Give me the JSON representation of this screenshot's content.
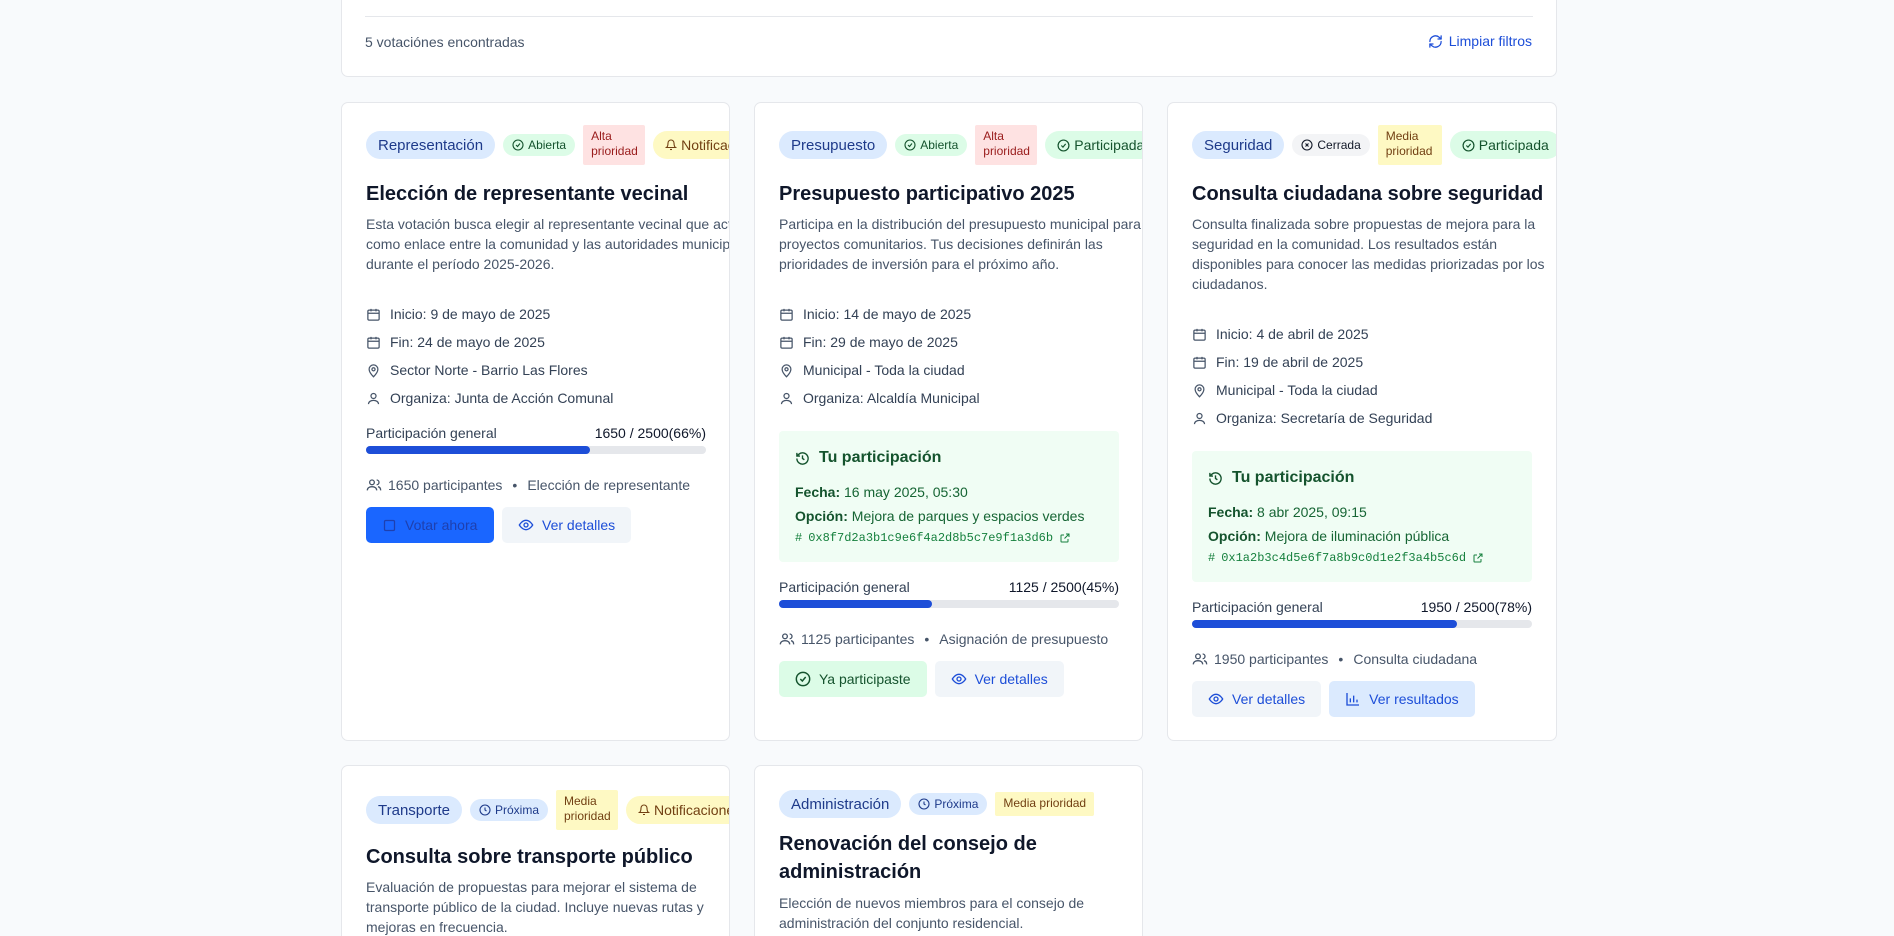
{
  "results": {
    "count_text": "5 votaciónes encontradas",
    "clear_label": "Limpiar filtros"
  },
  "cards": [
    {
      "category": "Representación",
      "status": "Abierta",
      "priority": "Alta prioridad",
      "extra_badge": "Notificaciones",
      "title": "Elección de representante vecinal",
      "description": "Esta votación busca elegir al representante vecinal que actuará como enlace entre la comunidad y las autoridades municipales durante el período 2025-2026.",
      "start": "Inicio: 9 de mayo de 2025",
      "end": "Fin: 24 de mayo de 2025",
      "location": "Sector Norte - Barrio Las Flores",
      "organizer": "Organiza: Junta de Acción Comunal",
      "progress_label": "Participación general",
      "progress_value": "1650 / 2500(66%)",
      "progress_fraction": 0.66,
      "participants": "1650 participantes",
      "vote_type": "Elección de representante",
      "primary_action": "Votar ahora",
      "details_action": "Ver detalles"
    },
    {
      "category": "Presupuesto",
      "status": "Abierta",
      "priority": "Alta prioridad",
      "extra_badge": "Participada",
      "title": "Presupuesto participativo 2025",
      "description": "Participa en la distribución del presupuesto municipal para proyectos comunitarios. Tus decisiones definirán las prioridades de inversión para el próximo año.",
      "start": "Inicio: 14 de mayo de 2025",
      "end": "Fin: 29 de mayo de 2025",
      "location": "Municipal - Toda la ciudad",
      "organizer": "Organiza: Alcaldía Municipal",
      "my_participation": {
        "title": "Tu participación",
        "date_label": "Fecha:",
        "date": "16 may 2025, 05:30",
        "option_label": "Opción:",
        "option": "Mejora de parques y espacios verdes",
        "hash": "0x8f7d2a3b1c9e6f4a2d8b5c7e9f1a3d6b"
      },
      "progress_label": "Participación general",
      "progress_value": "1125 / 2500(45%)",
      "progress_fraction": 0.45,
      "participants": "1125 participantes",
      "vote_type": "Asignación de presupuesto",
      "primary_action": "Ya participaste",
      "details_action": "Ver detalles"
    },
    {
      "category": "Seguridad",
      "status": "Cerrada",
      "priority": "Media prioridad",
      "extra_badge": "Participada",
      "title": "Consulta ciudadana sobre seguridad",
      "description": "Consulta finalizada sobre propuestas de mejora para la seguridad en la comunidad. Los resultados están disponibles para conocer las medidas priorizadas por los ciudadanos.",
      "start": "Inicio: 4 de abril de 2025",
      "end": "Fin: 19 de abril de 2025",
      "location": "Municipal - Toda la ciudad",
      "organizer": "Organiza: Secretaría de Seguridad",
      "my_participation": {
        "title": "Tu participación",
        "date_label": "Fecha:",
        "date": "8 abr 2025, 09:15",
        "option_label": "Opción:",
        "option": "Mejora de iluminación pública",
        "hash": "0x1a2b3c4d5e6f7a8b9c0d1e2f3a4b5c6d"
      },
      "progress_label": "Participación general",
      "progress_value": "1950 / 2500(78%)",
      "progress_fraction": 0.78,
      "participants": "1950 participantes",
      "vote_type": "Consulta ciudadana",
      "details_action": "Ver detalles",
      "results_action": "Ver resultados"
    },
    {
      "category": "Transporte",
      "status": "Próxima",
      "priority": "Media prioridad",
      "extra_badge": "Notificaciones",
      "title": "Consulta sobre transporte público",
      "description": "Evaluación de propuestas para mejorar el sistema de transporte público de la ciudad. Incluye nuevas rutas y mejoras en frecuencia."
    },
    {
      "category": "Administración",
      "status": "Próxima",
      "priority": "Media prioridad",
      "title": "Renovación del consejo de administración",
      "description": "Elección de nuevos miembros para el consejo de administración del conjunto residencial."
    }
  ],
  "colors": {
    "accent": "#1d4ed8",
    "progress_fill": "#1d4ed8",
    "success_bg": "#f0fdf4"
  }
}
